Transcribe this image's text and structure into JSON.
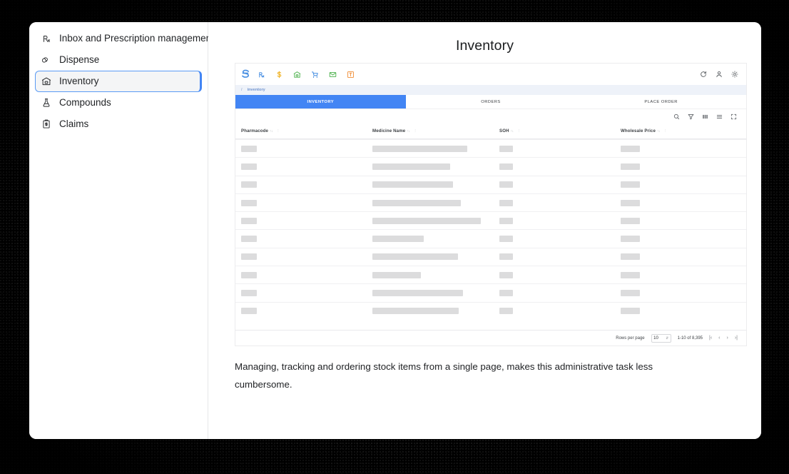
{
  "sidebar": {
    "items": [
      {
        "label": "Inbox and Prescription management",
        "icon": "rx-icon",
        "active": false
      },
      {
        "label": "Dispense",
        "icon": "pill-icon",
        "active": false
      },
      {
        "label": "Inventory",
        "icon": "box-icon",
        "active": true
      },
      {
        "label": "Compounds",
        "icon": "flask-icon",
        "active": false
      },
      {
        "label": "Claims",
        "icon": "clipboard-money-icon",
        "active": false
      }
    ]
  },
  "content": {
    "title": "Inventory",
    "caption": "Managing, tracking and ordering stock items from a single page, makes this administrative task less cumbersome."
  },
  "screenshot": {
    "brand": {
      "name": "s-logo",
      "color": "#4a90e2"
    },
    "app_icons": [
      {
        "name": "rx-icon",
        "color": "#4a90e2"
      },
      {
        "name": "dollar-icon",
        "color": "#f0b429"
      },
      {
        "name": "store-icon",
        "color": "#5cb85c"
      },
      {
        "name": "cart-icon",
        "color": "#4a90e2"
      },
      {
        "name": "envelope-icon",
        "color": "#5cb85c"
      },
      {
        "name": "orange-square-icon",
        "color": "#f2994a"
      }
    ],
    "top_actions": [
      {
        "name": "refresh-icon"
      },
      {
        "name": "user-icon"
      },
      {
        "name": "gear-icon"
      }
    ],
    "breadcrumb": {
      "separator": "/",
      "current": "inventory"
    },
    "tabs": [
      {
        "label": "INVENTORY",
        "active": true
      },
      {
        "label": "ORDERS",
        "active": false
      },
      {
        "label": "PLACE ORDER",
        "active": false
      }
    ],
    "table_toolbar": [
      {
        "name": "search-icon"
      },
      {
        "name": "filter-icon"
      },
      {
        "name": "columns-icon"
      },
      {
        "name": "density-icon"
      },
      {
        "name": "fullscreen-icon"
      }
    ],
    "table": {
      "columns": [
        {
          "label": "Pharmacode",
          "sort": "↑↓",
          "kebab": "⋮"
        },
        {
          "label": "Medicine Name",
          "sort": "↑↓",
          "kebab": "⋮"
        },
        {
          "label": "SOH",
          "sort": "↑↓",
          "kebab": "⋮"
        },
        {
          "label": "Wholesale Price",
          "sort": "↑↓",
          "kebab": "⋮"
        }
      ],
      "skeleton_rows": [
        {
          "name_width": 133
        },
        {
          "name_width": 109
        },
        {
          "name_width": 113
        },
        {
          "name_width": 124
        },
        {
          "name_width": 152
        },
        {
          "name_width": 72
        },
        {
          "name_width": 120
        },
        {
          "name_width": 68
        },
        {
          "name_width": 127
        },
        {
          "name_width": 121
        }
      ]
    },
    "pagination": {
      "rows_per_page_label": "Rows per page",
      "rows_per_page_value": "10",
      "range": "1-10 of 8,395",
      "first": "|‹",
      "prev": "‹",
      "next": "›",
      "last": "›|"
    }
  },
  "colors": {
    "accent_blue": "#4285f4",
    "card_white": "#ffffff",
    "backdrop": "#000000",
    "skeleton": "#dcdcdd"
  }
}
